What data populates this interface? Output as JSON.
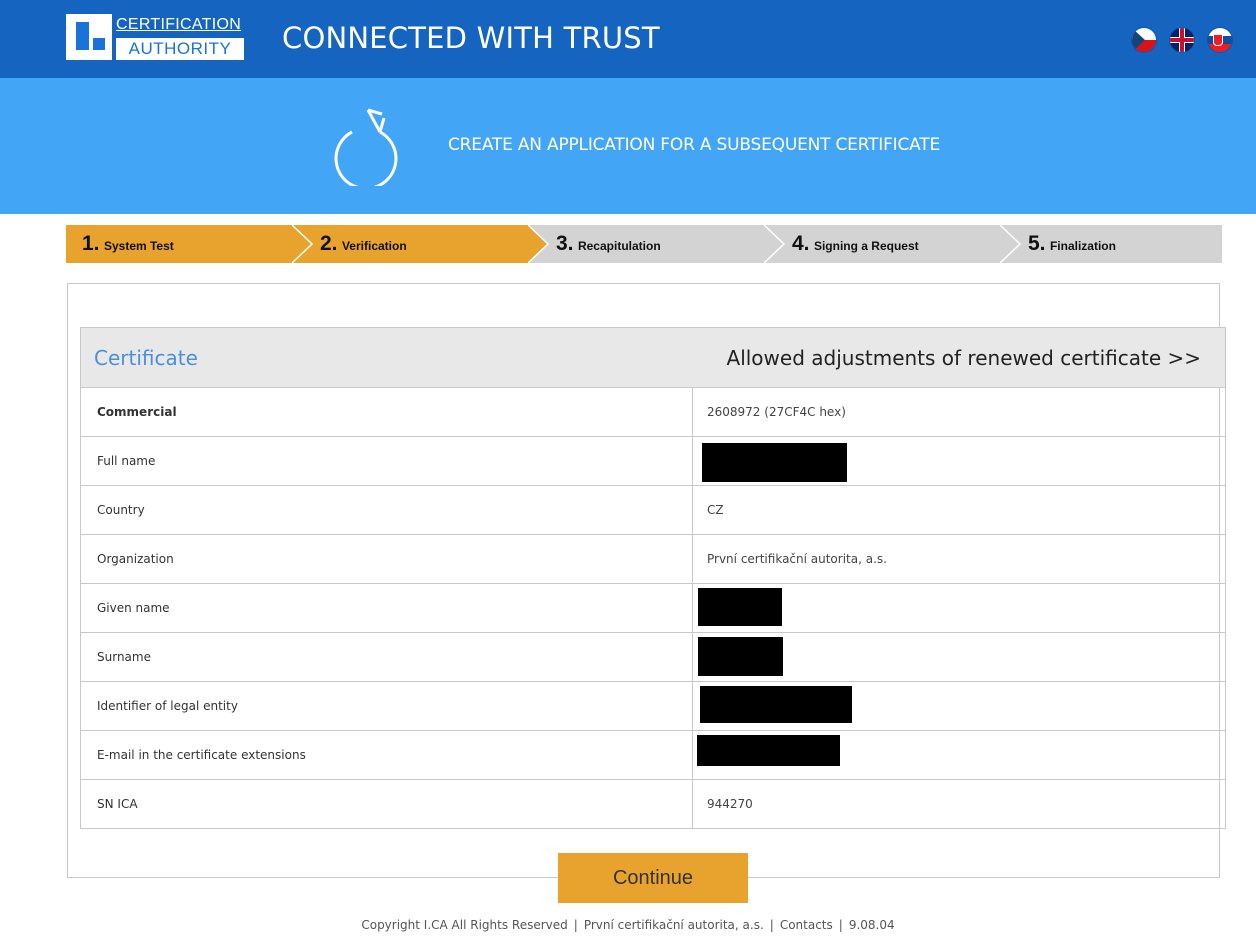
{
  "header": {
    "logo_line1": "CERTIFICATION",
    "logo_line2": "AUTHORITY",
    "tagline": "CONNECTED WITH TRUST",
    "languages": [
      "cz-flag-icon",
      "gb-flag-icon",
      "sk-flag-icon"
    ]
  },
  "banner": {
    "icon": "renew-icon",
    "title": "CREATE AN APPLICATION FOR A SUBSEQUENT CERTIFICATE"
  },
  "steps": [
    {
      "num": "1.",
      "label": "System Test",
      "state": "done"
    },
    {
      "num": "2.",
      "label": "Verification",
      "state": "active"
    },
    {
      "num": "3.",
      "label": "Recapitulation",
      "state": "pending"
    },
    {
      "num": "4.",
      "label": "Signing a Request",
      "state": "pending"
    },
    {
      "num": "5.",
      "label": "Finalization",
      "state": "pending"
    }
  ],
  "certificate": {
    "title": "Certificate",
    "adjustments_link": "Allowed adjustments of renewed certificate >>",
    "rows": [
      {
        "key": "Commercial",
        "value": "2608972 (27CF4C hex)",
        "redacted": false
      },
      {
        "key": "Full name",
        "value": "",
        "redacted": true
      },
      {
        "key": "Country",
        "value": "CZ",
        "redacted": false
      },
      {
        "key": "Organization",
        "value": "První certifikační autorita, a.s.",
        "redacted": false
      },
      {
        "key": "Given name",
        "value": "",
        "redacted": true
      },
      {
        "key": "Surname",
        "value": "",
        "redacted": true
      },
      {
        "key": "Identifier of legal entity",
        "value": "",
        "redacted": true
      },
      {
        "key": "E-mail in the certificate extensions",
        "value": "",
        "redacted": true
      },
      {
        "key": "SN ICA",
        "value": "944270",
        "redacted": false
      }
    ]
  },
  "actions": {
    "continue_label": "Continue"
  },
  "footer": {
    "copyright": "Copyright I.CA All Rights Reserved",
    "company": "První certifikační autorita, a.s.",
    "contacts": "Contacts",
    "version": "9.08.04"
  },
  "colors": {
    "topbar": "#1565c0",
    "banner": "#42a5f5",
    "step_active": "#e8a32f",
    "step_pending": "#d3d3d3",
    "button": "#e8a32f",
    "cert_title": "#4a90d9"
  }
}
